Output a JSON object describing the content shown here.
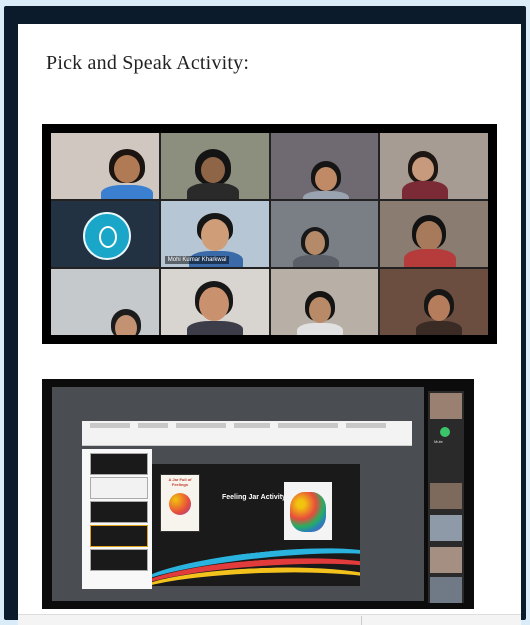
{
  "document": {
    "heading": "Pick and Speak Activity:"
  },
  "photo_call_grid": {
    "name_tag": "Mohi Kumar Kharkwal"
  },
  "photo_screen_share": {
    "slide_title": "Feeling Jar Activity",
    "book_title": "A Jar Full of Feelings",
    "mic_label": "Mute"
  },
  "colors": {
    "page_bg": "#ffffff",
    "frame": "#0b1b2c",
    "backdrop": "#d9ecf7",
    "logo_teal": "#1aa6c8"
  }
}
